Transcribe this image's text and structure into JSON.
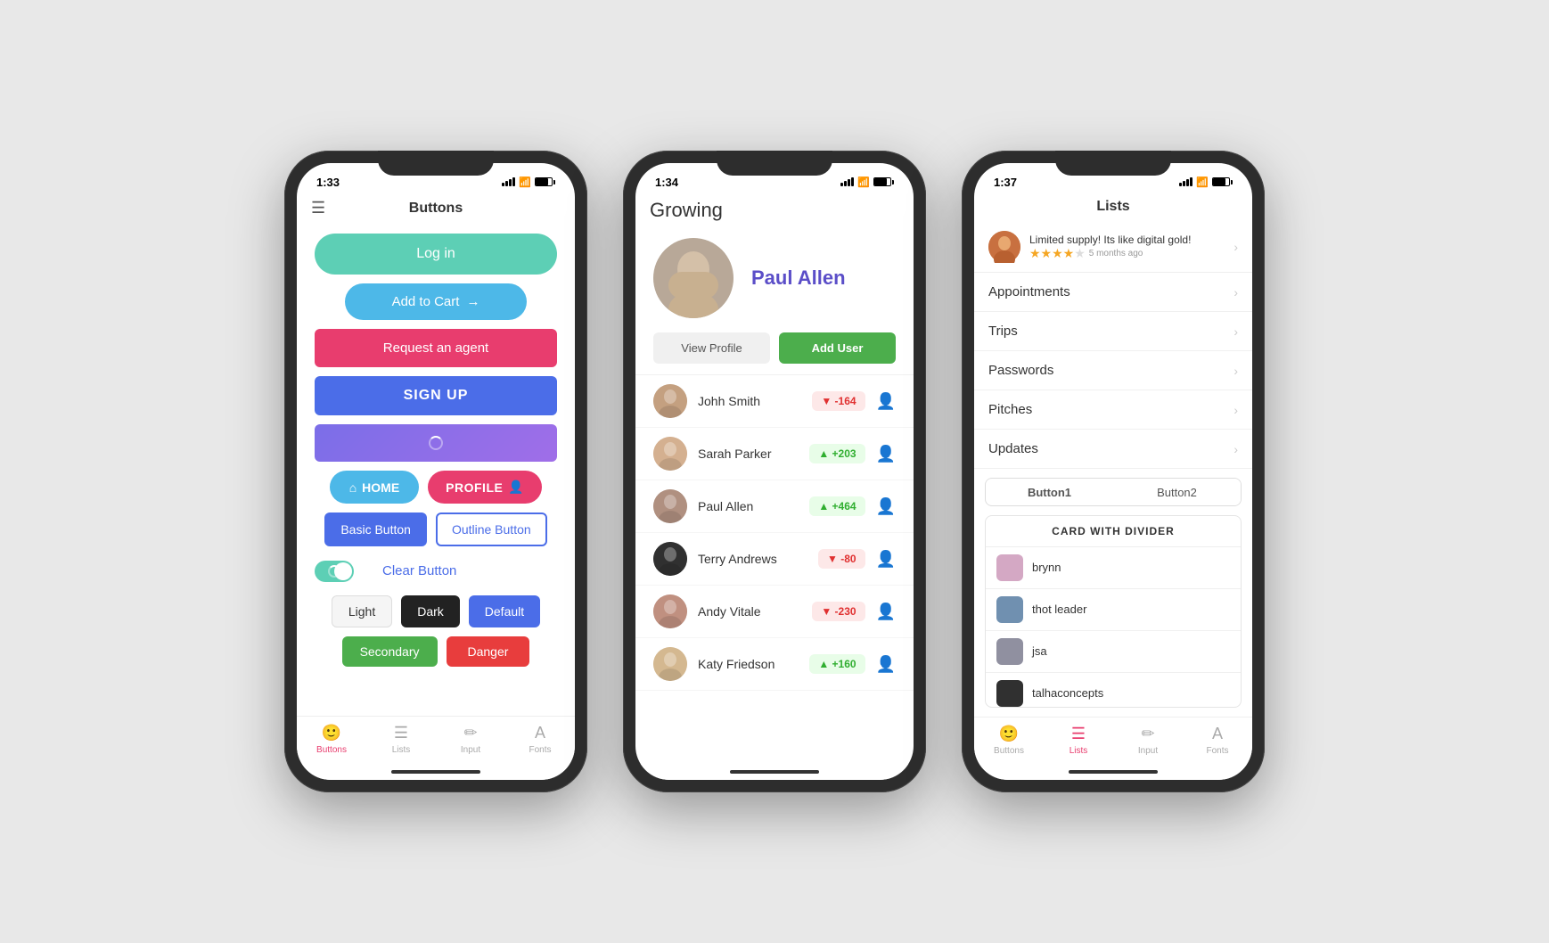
{
  "phone1": {
    "time": "1:33",
    "title": "Buttons",
    "buttons": {
      "login": "Log in",
      "addcart": "Add to Cart",
      "request": "Request an agent",
      "signup": "SIGN UP",
      "home": "HOME",
      "profile": "PROFILE",
      "basic": "Basic Button",
      "outline": "Outline Button",
      "clear": "Clear Button",
      "light": "Light",
      "dark": "Dark",
      "default": "Default",
      "secondary": "Secondary",
      "danger": "Danger"
    },
    "tabs": [
      "Buttons",
      "Lists",
      "Input",
      "Fonts"
    ]
  },
  "phone2": {
    "time": "1:34",
    "app_title": "Growing",
    "profile_name": "Paul Allen",
    "btn_view_profile": "View Profile",
    "btn_add_user": "Add User",
    "users": [
      {
        "name": "Johh Smith",
        "score": "-164",
        "positive": false
      },
      {
        "name": "Sarah Parker",
        "score": "+203",
        "positive": true
      },
      {
        "name": "Paul Allen",
        "score": "+464",
        "positive": true
      },
      {
        "name": "Terry Andrews",
        "score": "-80",
        "positive": false
      },
      {
        "name": "Andy Vitale",
        "score": "-230",
        "positive": false
      },
      {
        "name": "Katy Friedson",
        "score": "+160",
        "positive": true
      }
    ]
  },
  "phone3": {
    "time": "1:37",
    "title": "Lists",
    "review": {
      "text": "Limited supply! Its like digital gold!",
      "time": "5 months ago",
      "stars": 4
    },
    "list_items": [
      "Appointments",
      "Trips",
      "Passwords",
      "Pitches",
      "Updates"
    ],
    "segment_tabs": [
      "Button1",
      "Button2"
    ],
    "card_title": "CARD WITH DIVIDER",
    "card_items": [
      "brynn",
      "thot leader",
      "jsa",
      "talhaconcepts"
    ]
  }
}
